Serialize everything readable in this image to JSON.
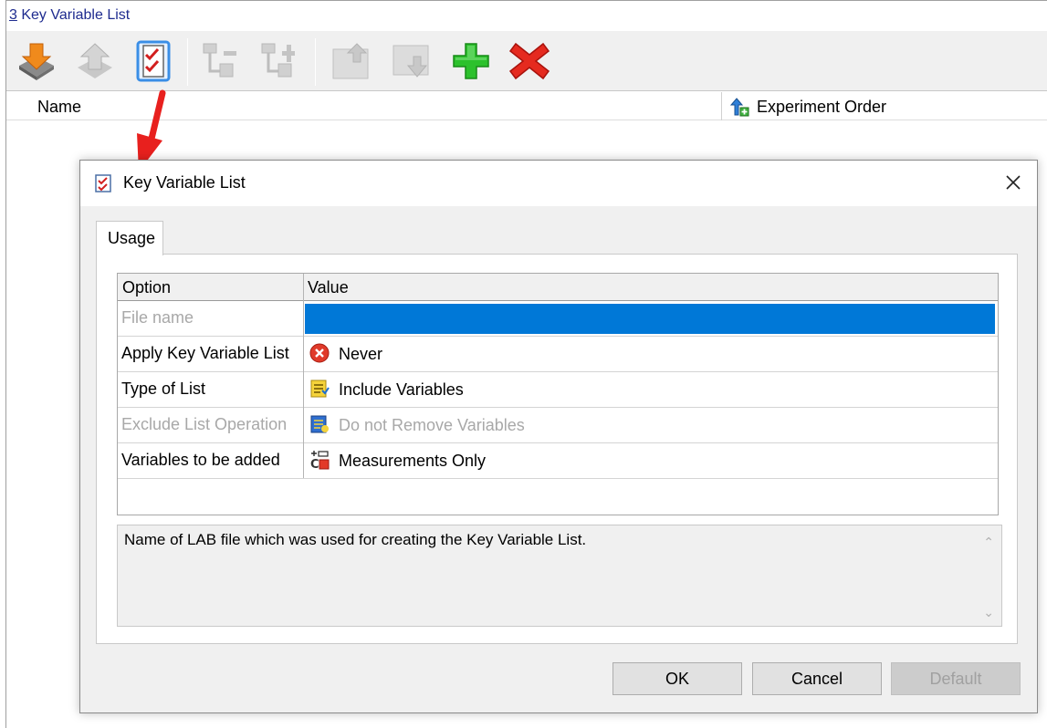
{
  "window": {
    "title_accel": "3",
    "title_rest": " Key Variable List"
  },
  "toolbar": {
    "buttons": [
      {
        "icon": "import-arrow-icon",
        "enabled": true
      },
      {
        "icon": "export-arrow-icon",
        "enabled": false
      },
      {
        "icon": "checklist-icon",
        "enabled": true
      },
      {
        "icon": "collapse-tree-icon",
        "enabled": false
      },
      {
        "icon": "expand-tree-icon",
        "enabled": false
      },
      {
        "icon": "move-up-icon",
        "enabled": false
      },
      {
        "icon": "move-down-icon",
        "enabled": false
      },
      {
        "icon": "add-icon",
        "enabled": true,
        "color": "#22b022"
      },
      {
        "icon": "delete-icon",
        "enabled": true,
        "color": "#e02020"
      }
    ]
  },
  "columns": {
    "name": "Name",
    "experiment_order": "Experiment Order"
  },
  "dialog": {
    "title": "Key Variable List",
    "tab": "Usage",
    "grid": {
      "header_option": "Option",
      "header_value": "Value",
      "rows": [
        {
          "option": "File name",
          "value": "",
          "disabled": true,
          "selected": true
        },
        {
          "option": "Apply Key Variable List",
          "value": "Never",
          "icon": "error-circle-icon"
        },
        {
          "option": "Type of List",
          "value": "Include Variables",
          "icon": "include-list-icon"
        },
        {
          "option": "Exclude List Operation",
          "value": "Do not Remove Variables",
          "icon": "exclude-list-icon",
          "disabled": true
        },
        {
          "option": "Variables to be added",
          "value": "Measurements Only",
          "icon": "measurement-icon"
        }
      ]
    },
    "description": "Name of LAB file which was used for creating the Key Variable List.",
    "buttons": {
      "ok": "OK",
      "cancel": "Cancel",
      "default": "Default"
    }
  },
  "colors": {
    "selection": "#0078d7",
    "annotation_arrow": "#e8201e",
    "title_link": "#1e2b8f"
  }
}
